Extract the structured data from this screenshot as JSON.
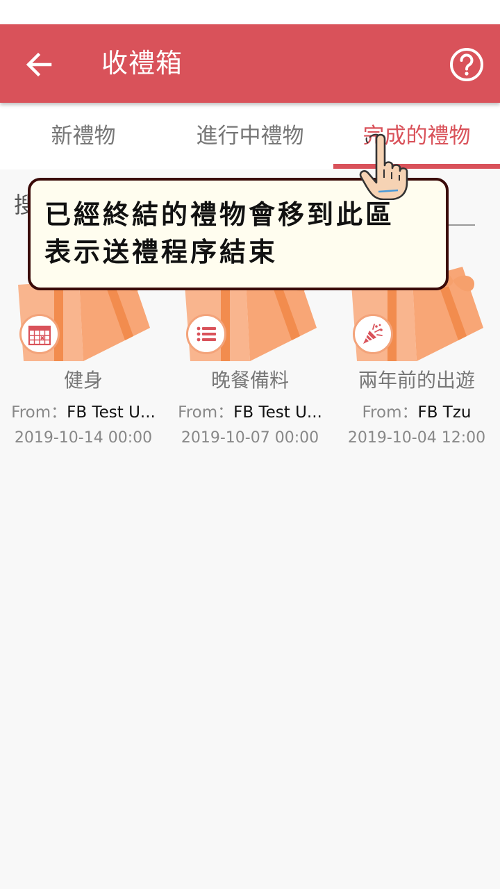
{
  "app_bar": {
    "title": "收禮箱",
    "back_icon": "arrow-left-icon",
    "help_icon": "help-circle-icon"
  },
  "tabs": [
    {
      "label": "新禮物",
      "active": false
    },
    {
      "label": "進行中禮物",
      "active": false
    },
    {
      "label": "完成的禮物",
      "active": true
    }
  ],
  "search": {
    "label": "搜"
  },
  "tooltip": {
    "line1": "已經終結的禮物會移到此區",
    "line2": "表示送禮程序結束"
  },
  "gifts": [
    {
      "name": "健身",
      "from_label": "From：",
      "sender": "FB Test U...",
      "date": "2019-10-14 00:00",
      "icon": "calendar-icon"
    },
    {
      "name": "晚餐備料",
      "from_label": "From：",
      "sender": "FB Test U...",
      "date": "2019-10-07 00:00",
      "icon": "list-icon"
    },
    {
      "name": "兩年前的出遊",
      "from_label": "From：",
      "sender": "FB Tzu",
      "date": "2019-10-04 12:00",
      "icon": "party-popper-icon"
    }
  ],
  "colors": {
    "primary": "#d9525a",
    "gift_box": "#f8b48d",
    "tooltip_bg": "#fffdef",
    "tooltip_border": "#3a0a08"
  }
}
